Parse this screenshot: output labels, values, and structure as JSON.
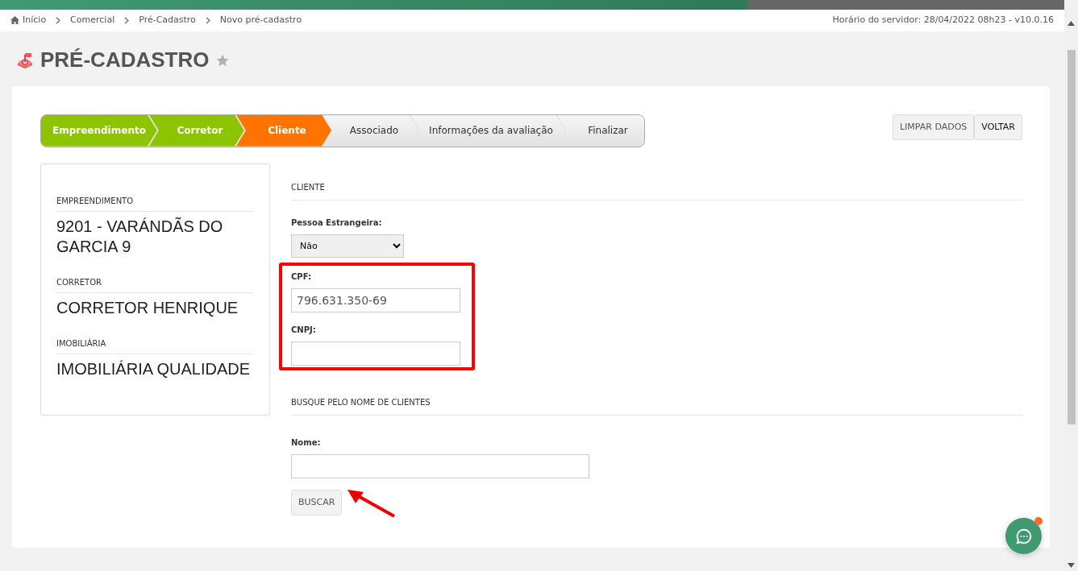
{
  "breadcrumb": [
    {
      "label": "Início"
    },
    {
      "label": "Comercial"
    },
    {
      "label": "Pré-Cadastro"
    },
    {
      "label": "Novo pré-cadastro"
    }
  ],
  "server_info": "Horário do servidor: 28/04/2022 08h23 - v10.0.16",
  "page": {
    "title": "PRÉ-CADASTRO",
    "favorite": false
  },
  "steps": [
    {
      "label": "Empreendimento",
      "done": true,
      "selected": false
    },
    {
      "label": "Corretor",
      "done": true,
      "selected": false
    },
    {
      "label": "Cliente",
      "done": false,
      "selected": true
    },
    {
      "label": "Associado",
      "done": false,
      "selected": false
    },
    {
      "label": "Informações da avaliação",
      "done": false,
      "selected": false
    },
    {
      "label": "Finalizar",
      "done": false,
      "selected": false
    }
  ],
  "header_buttons": [
    "LIMPAR DADOS",
    "VOLTAR"
  ],
  "summary": [
    {
      "label": "EMPREENDIMENTO",
      "value": "9201 - VARÁNDÃS DO GARCIA 9"
    },
    {
      "label": "CORRETOR",
      "value": "CORRETOR HENRIQUE"
    },
    {
      "label": "IMOBILIÁRIA",
      "value": "IMOBILIÁRIA QUALIDADE"
    }
  ],
  "client_section": {
    "title": "CLIENTE",
    "foreign": {
      "label": "Pessoa Estrangeira:",
      "value": "Não"
    },
    "highlighted_fields": [
      {
        "label": "CPF:",
        "value": "796.631.350-69"
      },
      {
        "label": "CNPJ:"
      }
    ]
  },
  "search_section": {
    "title": "BUSQUE PELO NOME DE CLIENTES",
    "name_field": {
      "label": "Nome:"
    },
    "button": "BUSCAR"
  },
  "chat": {
    "notification": true
  }
}
